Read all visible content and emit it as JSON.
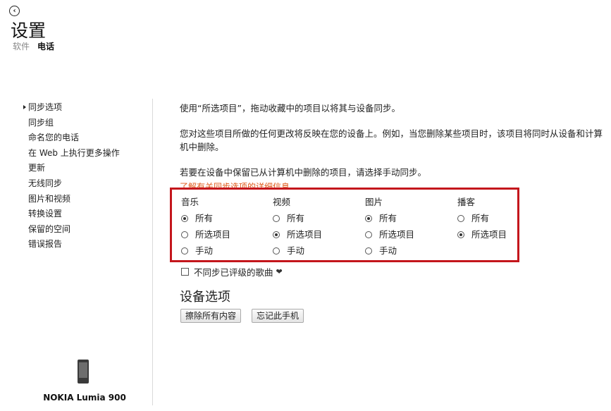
{
  "header": {
    "back_icon": "‹",
    "title": "设置",
    "breadcrumb": [
      "软件",
      "电话"
    ]
  },
  "sidebar": {
    "items": [
      "同步选项",
      "同步组",
      "命名您的电话",
      "在 Web 上执行更多操作",
      "更新",
      "无线同步",
      "图片和视频",
      "转换设置",
      "保留的空间",
      "错误报告"
    ],
    "active_index": 0
  },
  "device": {
    "name": "NOKIA Lumia 900"
  },
  "content": {
    "p1": "使用“所选项目”，拖动收藏中的项目以将其与设备同步。",
    "p2": "您对这些项目所做的任何更改将反映在您的设备上。例如，当您删除某些项目时，该项目将同时从设备和计算机中删除。",
    "p3": "若要在设备中保留已从计算机中删除的项目，请选择手动同步。",
    "link": "了解有关同步选项的详细信息",
    "columns": [
      {
        "header": "音乐",
        "options": [
          "所有",
          "所选项目",
          "手动"
        ],
        "selected": 0
      },
      {
        "header": "视频",
        "options": [
          "所有",
          "所选项目",
          "手动"
        ],
        "selected": 1
      },
      {
        "header": "图片",
        "options": [
          "所有",
          "所选项目",
          "手动"
        ],
        "selected": 0
      },
      {
        "header": "播客",
        "options": [
          "所有",
          "所选项目"
        ],
        "selected": 1
      }
    ],
    "checkbox_label": "不同步已评级的歌曲",
    "checkbox_checked": false,
    "heart_icon": "❤",
    "device_options_title": "设备选项",
    "buttons": {
      "erase": "擦除所有内容",
      "forget": "忘记此手机"
    }
  },
  "colors": {
    "highlight_border": "#c4161c",
    "link": "#e0591a"
  }
}
